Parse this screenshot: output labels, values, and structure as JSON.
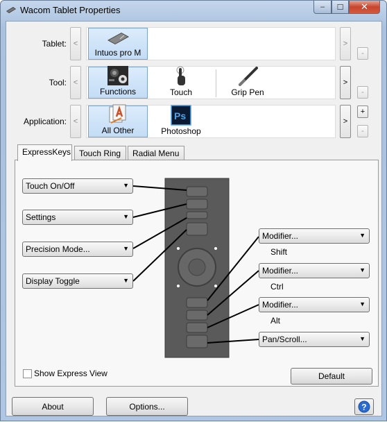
{
  "window": {
    "title": "Wacom Tablet Properties",
    "controls": {
      "minimize": "–",
      "maximize": "☐",
      "close": "✕"
    }
  },
  "tablet": {
    "label": "Tablet:",
    "items": [
      {
        "label": "Intuos pro M",
        "icon": "tablet-icon",
        "selected": true
      }
    ],
    "remove": "-",
    "prev": "<",
    "next": ">"
  },
  "tool": {
    "label": "Tool:",
    "items": [
      {
        "label": "Functions",
        "icon": "functions-icon",
        "selected": true
      },
      {
        "label": "Touch",
        "icon": "touch-hand-icon",
        "selected": false
      },
      {
        "label": "Grip Pen",
        "icon": "grip-pen-icon",
        "selected": false
      }
    ],
    "remove": "-",
    "prev": "<",
    "next": ">"
  },
  "application": {
    "label": "Application:",
    "items": [
      {
        "label": "All Other",
        "icon": "all-other-apps-icon",
        "selected": true
      },
      {
        "label": "Photoshop",
        "icon": "photoshop-icon",
        "selected": false
      }
    ],
    "add": "+",
    "remove": "-",
    "prev": "<",
    "next": ">"
  },
  "tabs": [
    {
      "label": "ExpressKeys",
      "active": true
    },
    {
      "label": "Touch Ring",
      "active": false
    },
    {
      "label": "Radial Menu",
      "active": false
    }
  ],
  "expresskeys": {
    "left": [
      {
        "value": "Touch On/Off"
      },
      {
        "value": "Settings"
      },
      {
        "value": "Precision Mode..."
      },
      {
        "value": "Display Toggle"
      }
    ],
    "right": [
      {
        "value": "Modifier...",
        "sub": "Shift"
      },
      {
        "value": "Modifier...",
        "sub": "Ctrl"
      },
      {
        "value": "Modifier...",
        "sub": "Alt"
      },
      {
        "value": "Pan/Scroll...",
        "sub": ""
      }
    ],
    "show_express_view": "Show Express View",
    "default_button": "Default"
  },
  "footer": {
    "about": "About",
    "options": "Options...",
    "help": "?"
  },
  "colors": {
    "selection_fill": "#c3dcf5",
    "selection_border": "#7da2ce",
    "tablet_graphic": "#555555",
    "help_blue": "#2a6bd1"
  }
}
